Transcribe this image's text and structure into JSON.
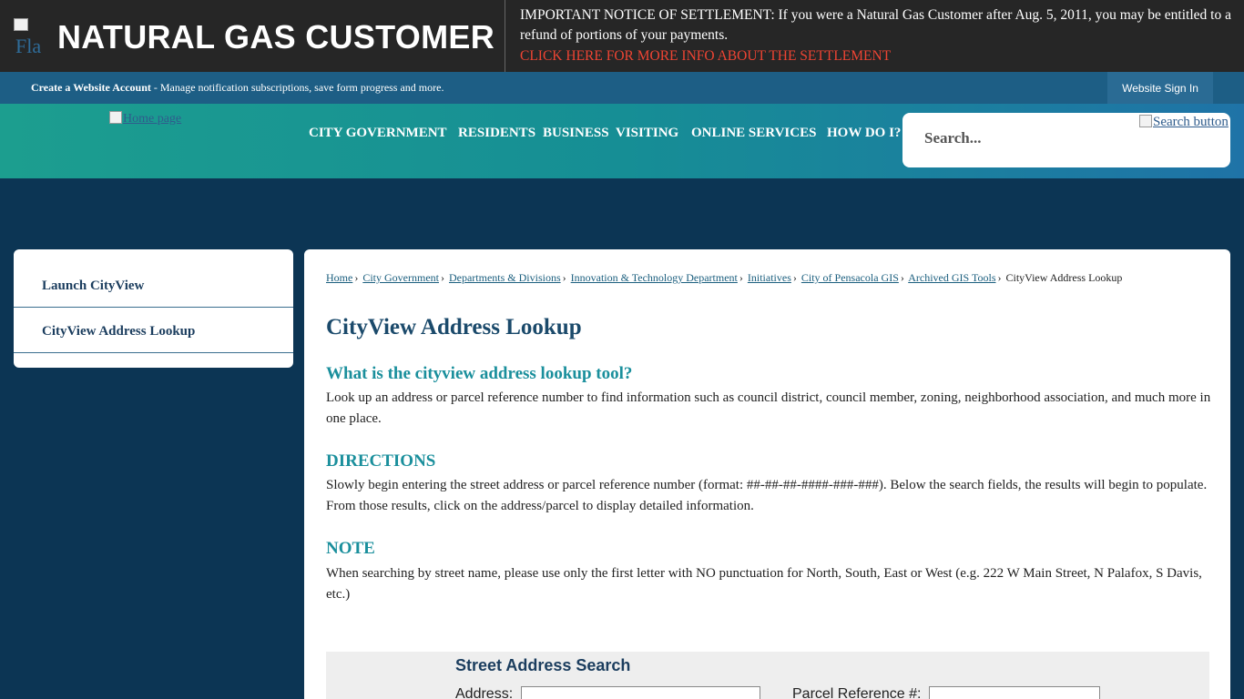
{
  "alert": {
    "title": "NATURAL GAS CUSTOMER",
    "image_alt": "Fla",
    "notice": "IMPORTANT NOTICE OF SETTLEMENT: If you were a Natural Gas Customer after Aug. 5, 2011, you may be entitled to a refund of portions of your payments.",
    "link": "CLICK HERE FOR MORE INFO ABOUT THE SETTLEMENT"
  },
  "account": {
    "create_label": "Create a Website Account",
    "create_desc": " - Manage notification subscriptions, save form progress and more.",
    "signin_label": "Website Sign In"
  },
  "header": {
    "home_alt": "Home page",
    "nav": [
      "CITY GOVERNMENT",
      "RESIDENTS",
      "BUSINESS",
      "VISITING",
      "ONLINE SERVICES",
      "HOW DO I?"
    ],
    "search_placeholder": "Search...",
    "search_button_alt": "Search button"
  },
  "sidebar": {
    "items": [
      {
        "label": "Launch CityView"
      },
      {
        "label": "CityView Address Lookup"
      }
    ]
  },
  "breadcrumb": {
    "links": [
      "Home",
      "City Government",
      "Departments & Divisions",
      "Innovation & Technology Department",
      "Initiatives",
      "City of Pensacola GIS",
      "Archived GIS Tools"
    ],
    "separator": "›",
    "current": "CityView Address Lookup"
  },
  "content": {
    "title": "CityView Address Lookup",
    "sections": [
      {
        "heading": "What is the cityview address lookup tool?",
        "body": "Look up an address or parcel reference number to find information such as council district, council member, zoning, neighborhood association, and much more in one place."
      },
      {
        "heading": "DIRECTIONS",
        "body": "Slowly begin entering the street address or parcel reference number (format: ##-##-##-####-###-###). Below the search fields, the results will begin to populate. From those results, click on the address/parcel to display detailed information."
      },
      {
        "heading": "NOTE",
        "body": "When searching by street name, please use only the first letter with NO punctuation for North, South, East or West (e.g. 222 W Main Street, N Palafox, S Davis, etc.)"
      }
    ]
  },
  "search_panel": {
    "title": "Street Address Search",
    "address_label": "Address:",
    "address_value": "",
    "parcel_label": "Parcel Reference #:",
    "parcel_value": ""
  }
}
